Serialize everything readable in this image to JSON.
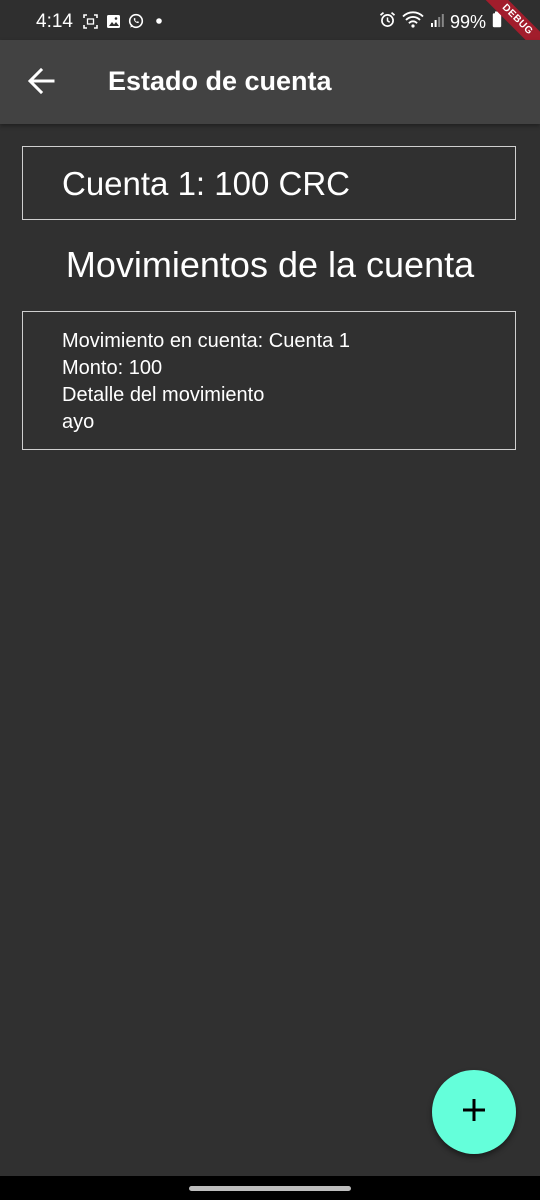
{
  "status_bar": {
    "time": "4:14",
    "battery": "99%",
    "left_icons": [
      "screenshot-icon",
      "image-icon",
      "whatsapp-icon",
      "dot-icon"
    ],
    "right_icons": [
      "alarm-icon",
      "wifi-icon",
      "signal-icon",
      "battery-icon"
    ]
  },
  "debug_banner": "DEBUG",
  "app_bar": {
    "title": "Estado de cuenta",
    "back_icon": "arrow-back-icon"
  },
  "account": {
    "summary": "Cuenta 1: 100 CRC"
  },
  "movements": {
    "heading": "Movimientos de la cuenta",
    "items": [
      {
        "account_line": "Movimiento en cuenta: Cuenta 1",
        "amount_line": "Monto: 100",
        "detail_label": "Detalle del movimiento",
        "detail": "ayo"
      }
    ]
  },
  "fab": {
    "icon": "plus-icon"
  },
  "colors": {
    "background": "#303030",
    "app_bar": "#424242",
    "fab": "#64ffda",
    "debug_banner": "#a21d2c"
  }
}
